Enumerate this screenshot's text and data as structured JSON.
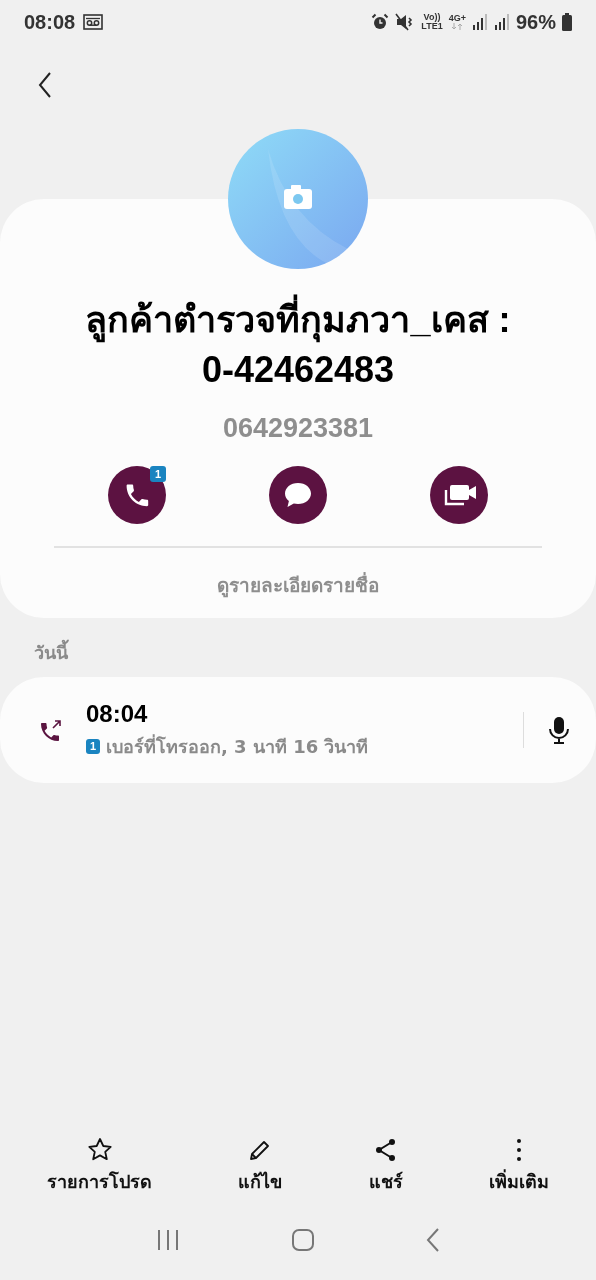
{
  "status_bar": {
    "time": "08:08",
    "volte": "Vo))",
    "lte": "LTE1",
    "network": "4G+",
    "battery": "96%"
  },
  "contact": {
    "name": "ลูกค้าตำรวจที่กุมภวา_เคส : 0-42462483",
    "phone": "0642923381",
    "actions": [
      {
        "kind": "call",
        "badge": "1"
      },
      {
        "kind": "message"
      },
      {
        "kind": "video"
      }
    ],
    "details_link": "ดูรายละเอียดรายชื่อ"
  },
  "section_label": "วันนี้",
  "call_log": [
    {
      "kind": "outgoing",
      "time": "08:04",
      "sim_badge": "1",
      "description": "เบอร์ที่โทรออก, 3 นาที 16 วินาที"
    }
  ],
  "bottom_actions": [
    {
      "kind": "favorite",
      "label": "รายการโปรด"
    },
    {
      "kind": "edit",
      "label": "แก้ไข"
    },
    {
      "kind": "share",
      "label": "แชร์"
    },
    {
      "kind": "more",
      "label": "เพิ่มเติม"
    }
  ]
}
